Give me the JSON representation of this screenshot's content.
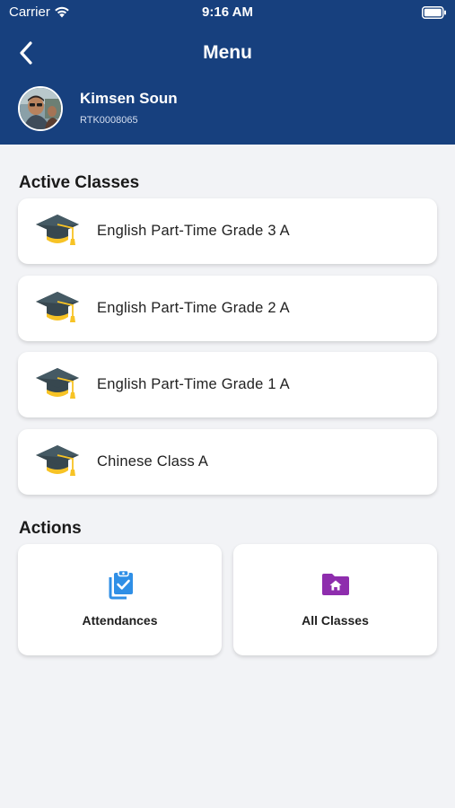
{
  "status_bar": {
    "carrier": "Carrier",
    "time": "9:16 AM"
  },
  "nav": {
    "title": "Menu",
    "back_icon": "chevron-left-icon"
  },
  "profile": {
    "name": "Kimsen Soun",
    "id": "RTK0008065"
  },
  "active_classes": {
    "title": "Active Classes",
    "icon": "graduation-cap-icon",
    "items": [
      {
        "label": "English Part-Time Grade 3 A"
      },
      {
        "label": "English Part-Time Grade 2 A"
      },
      {
        "label": "English Part-Time Grade 1 A"
      },
      {
        "label": "Chinese Class A"
      }
    ]
  },
  "actions": {
    "title": "Actions",
    "items": [
      {
        "label": "Attendances",
        "icon": "clipboard-check-icon",
        "color": "#2f8fe6"
      },
      {
        "label": "All Classes",
        "icon": "folder-home-icon",
        "color": "#8e2dad"
      }
    ]
  },
  "colors": {
    "header": "#17407e",
    "background": "#f2f3f6",
    "cap_dark": "#37474f",
    "cap_gold": "#f7c325"
  }
}
